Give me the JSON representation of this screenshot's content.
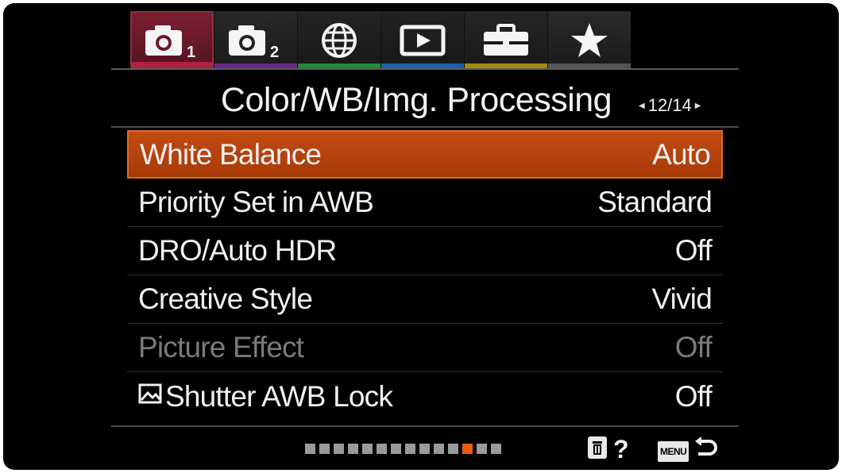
{
  "tabs": [
    {
      "icon": "camera-1-icon",
      "badge": "1",
      "stripe": "#b02040",
      "active": true
    },
    {
      "icon": "camera-2-icon",
      "badge": "2",
      "stripe": "#6a2a8a",
      "active": false
    },
    {
      "icon": "globe-icon",
      "badge": "",
      "stripe": "#1f8a3a",
      "active": false
    },
    {
      "icon": "playback-icon",
      "badge": "",
      "stripe": "#1f5fb0",
      "active": false
    },
    {
      "icon": "toolbox-icon",
      "badge": "",
      "stripe": "#a08a10",
      "active": false
    },
    {
      "icon": "star-icon",
      "badge": "",
      "stripe": "#555555",
      "active": false
    }
  ],
  "header": {
    "title": "Color/WB/Img. Processing",
    "page": "12/14"
  },
  "menu": [
    {
      "label": "White Balance",
      "value": "Auto",
      "state": "selected",
      "icon": ""
    },
    {
      "label": "Priority Set in AWB",
      "value": "Standard",
      "state": "normal",
      "icon": ""
    },
    {
      "label": "DRO/Auto HDR",
      "value": "Off",
      "state": "normal",
      "icon": ""
    },
    {
      "label": "Creative Style",
      "value": "Vivid",
      "state": "normal",
      "icon": ""
    },
    {
      "label": "Picture Effect",
      "value": "Off",
      "state": "disabled",
      "icon": ""
    },
    {
      "label": "Shutter AWB Lock",
      "value": "Off",
      "state": "normal",
      "icon": "image-frame-icon"
    }
  ],
  "footer": {
    "page_dots_total": 14,
    "page_dots_current": 12,
    "help_label": "?",
    "menu_label": "MENU"
  },
  "colors": {
    "accent": "#c24b12",
    "current_dot": "#f05a10"
  }
}
